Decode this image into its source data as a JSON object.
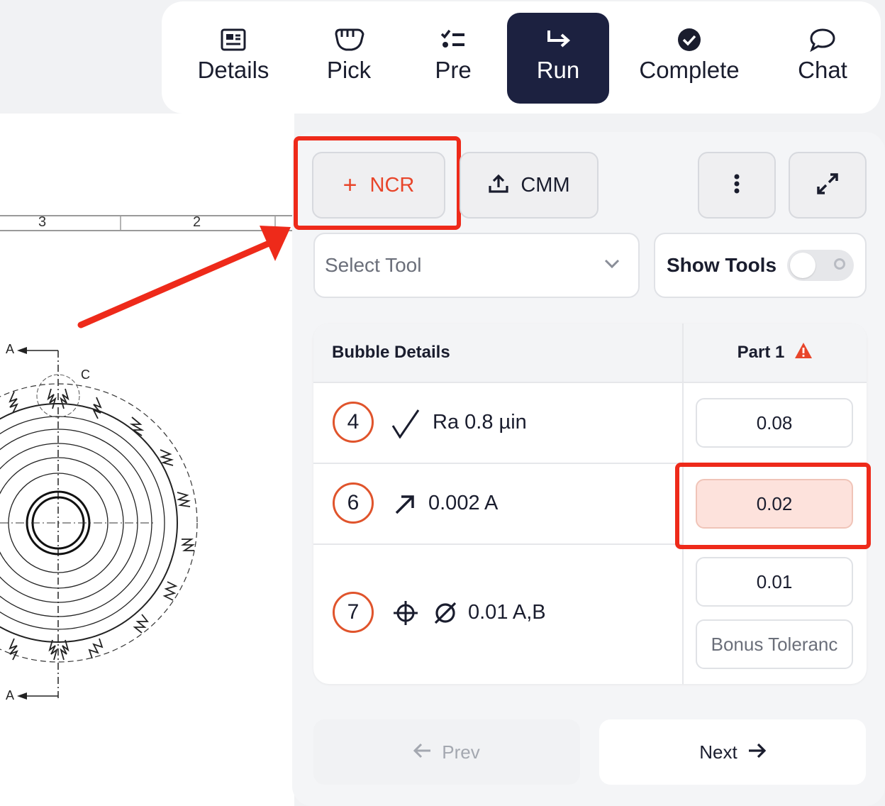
{
  "nav": {
    "items": [
      {
        "label": "Details",
        "icon": "details-card-icon"
      },
      {
        "label": "Pick",
        "icon": "hand-grab-icon"
      },
      {
        "label": "Pre",
        "icon": "checklist-icon"
      },
      {
        "label": "Run",
        "icon": "arrow-turn-right-icon",
        "active": true
      },
      {
        "label": "Complete",
        "icon": "check-circle-icon"
      },
      {
        "label": "Chat",
        "icon": "chat-bubble-icon"
      }
    ]
  },
  "drawing": {
    "ruler_labels": [
      "3",
      "2"
    ],
    "section_label_top": "A",
    "section_label_bottom": "A",
    "detail_label": "C"
  },
  "toolbar": {
    "ncr_label": "NCR",
    "ncr_icon": "plus-icon",
    "cmm_label": "CMM",
    "cmm_icon": "upload-icon",
    "more_icon": "more-vertical-icon",
    "expand_icon": "expand-icon"
  },
  "tool_select": {
    "placeholder": "Select Tool"
  },
  "show_tools": {
    "label": "Show Tools",
    "enabled": false
  },
  "table": {
    "header_bubble": "Bubble Details",
    "header_part": "Part 1",
    "rows": [
      {
        "bubble": "4",
        "spec": "Ra 0.8 µin",
        "symbol": "surface-finish-icon",
        "value": "0.08"
      },
      {
        "bubble": "6",
        "spec": "0.002 A",
        "symbol": "runout-arrow-icon",
        "value": "0.02",
        "flagged": true
      },
      {
        "bubble": "7",
        "spec": "0.01 A,B",
        "symbol": "position-icon",
        "value": "0.01",
        "bonus_placeholder": "Bonus Toleranc"
      }
    ]
  },
  "pager": {
    "prev_label": "Prev",
    "next_label": "Next"
  },
  "colors": {
    "accent_red": "#e8452a",
    "highlight_red": "#ee2a1a",
    "active_nav": "#1c2140",
    "flagged_fill": "#fde2dc"
  }
}
